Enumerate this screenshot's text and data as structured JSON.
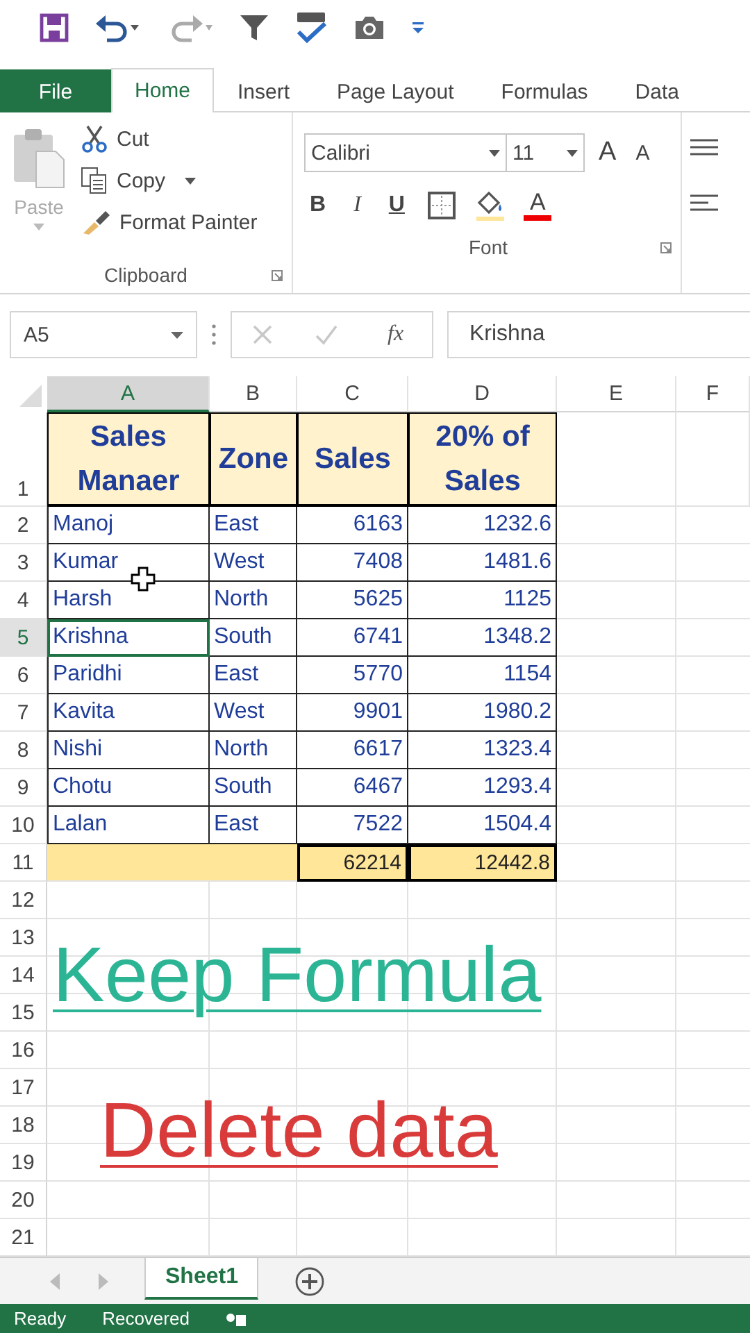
{
  "tabs": [
    {
      "label": "File",
      "kind": "file",
      "selected": false
    },
    {
      "label": "Home",
      "kind": "tab",
      "selected": true
    },
    {
      "label": "Insert",
      "kind": "tab",
      "selected": false
    },
    {
      "label": "Page Layout",
      "kind": "tab",
      "selected": false
    },
    {
      "label": "Formulas",
      "kind": "tab",
      "selected": false
    },
    {
      "label": "Data",
      "kind": "tab",
      "selected": false
    }
  ],
  "clipboard": {
    "paste": "Paste",
    "cut": "Cut",
    "copy": "Copy",
    "format_painter": "Format Painter",
    "group_label": "Clipboard"
  },
  "font": {
    "family": "Calibri",
    "size": "11",
    "grow": "A",
    "shrink": "A",
    "bold": "B",
    "italic": "I",
    "underline": "U",
    "font_color": "A",
    "group_label": "Font"
  },
  "formula_bar": {
    "name_box": "A5",
    "fx": "fx",
    "value": "Krishna"
  },
  "columns": [
    {
      "label": "A",
      "selected": true
    },
    {
      "label": "B",
      "selected": false
    },
    {
      "label": "C",
      "selected": false
    },
    {
      "label": "D",
      "selected": false
    },
    {
      "label": "E",
      "selected": false
    },
    {
      "label": "F",
      "selected": false
    }
  ],
  "rows": [
    {
      "number": "1",
      "kind": "header",
      "selected": false,
      "cells": [
        "Sales Manaer",
        "Zone",
        "Sales",
        "20% of Sales"
      ]
    },
    {
      "number": "2",
      "kind": "data",
      "selected": false,
      "cells": [
        "Manoj",
        "East",
        "6163",
        "1232.6"
      ]
    },
    {
      "number": "3",
      "kind": "data",
      "selected": false,
      "cells": [
        "Kumar",
        "West",
        "7408",
        "1481.6"
      ]
    },
    {
      "number": "4",
      "kind": "data",
      "selected": false,
      "cells": [
        "Harsh",
        "North",
        "5625",
        "1125"
      ]
    },
    {
      "number": "5",
      "kind": "data",
      "selected": true,
      "cells": [
        "Krishna",
        "South",
        "6741",
        "1348.2"
      ]
    },
    {
      "number": "6",
      "kind": "data",
      "selected": false,
      "cells": [
        "Paridhi",
        "East",
        "5770",
        "1154"
      ]
    },
    {
      "number": "7",
      "kind": "data",
      "selected": false,
      "cells": [
        "Kavita",
        "West",
        "9901",
        "1980.2"
      ]
    },
    {
      "number": "8",
      "kind": "data",
      "selected": false,
      "cells": [
        "Nishi",
        "North",
        "6617",
        "1323.4"
      ]
    },
    {
      "number": "9",
      "kind": "data",
      "selected": false,
      "cells": [
        "Chotu",
        "South",
        "6467",
        "1293.4"
      ]
    },
    {
      "number": "10",
      "kind": "data",
      "selected": false,
      "cells": [
        "Lalan",
        "East",
        "7522",
        "1504.4"
      ]
    },
    {
      "number": "11",
      "kind": "total",
      "selected": false,
      "cells": [
        "62214",
        "12442.8"
      ]
    },
    {
      "number": "12",
      "kind": "empty",
      "selected": false
    },
    {
      "number": "13",
      "kind": "empty",
      "selected": false
    },
    {
      "number": "14",
      "kind": "empty",
      "selected": false
    },
    {
      "number": "15",
      "kind": "empty",
      "selected": false
    },
    {
      "number": "16",
      "kind": "empty",
      "selected": false
    },
    {
      "number": "17",
      "kind": "empty",
      "selected": false
    },
    {
      "number": "18",
      "kind": "empty",
      "selected": false
    },
    {
      "number": "19",
      "kind": "empty",
      "selected": false
    },
    {
      "number": "20",
      "kind": "empty",
      "selected": false
    },
    {
      "number": "21",
      "kind": "empty",
      "selected": false
    }
  ],
  "annotations": [
    {
      "text": "Keep Formula",
      "color": "#2bb594"
    },
    {
      "text": "Delete data",
      "color": "#d93b3b"
    }
  ],
  "sheet_tabs": [
    {
      "label": "Sheet1",
      "selected": true
    }
  ],
  "status_bar": [
    "Ready",
    "Recovered"
  ]
}
